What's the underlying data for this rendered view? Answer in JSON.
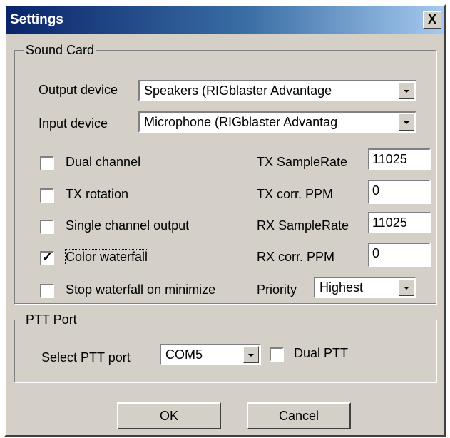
{
  "window": {
    "title": "Settings",
    "close_label": "X"
  },
  "sound_card": {
    "legend": "Sound Card",
    "output_device": {
      "label": "Output device",
      "value": "Speakers (RIGblaster Advantage"
    },
    "input_device": {
      "label": "Input device",
      "value": "Microphone (RIGblaster Advantag"
    },
    "options": [
      {
        "label": "Dual channel",
        "checked": false
      },
      {
        "label": "TX rotation",
        "checked": false
      },
      {
        "label": "Single channel output",
        "checked": false
      },
      {
        "label": "Color waterfall",
        "checked": true
      },
      {
        "label": "Stop waterfall on minimize",
        "checked": false
      }
    ],
    "check_mark": "✓",
    "tx_samplerate": {
      "label": "TX SampleRate",
      "value": "11025"
    },
    "tx_corr": {
      "label": "TX corr. PPM",
      "value": "0"
    },
    "rx_samplerate": {
      "label": "RX SampleRate",
      "value": "11025"
    },
    "rx_corr": {
      "label": "RX corr. PPM",
      "value": "0"
    },
    "priority": {
      "label": "Priority",
      "value": "Highest"
    }
  },
  "ptt_port": {
    "legend": "PTT Port",
    "select_label": "Select PTT port",
    "port_value": "COM5",
    "dual_ptt": {
      "label": "Dual PTT",
      "checked": false
    }
  },
  "buttons": {
    "ok": "OK",
    "cancel": "Cancel"
  }
}
